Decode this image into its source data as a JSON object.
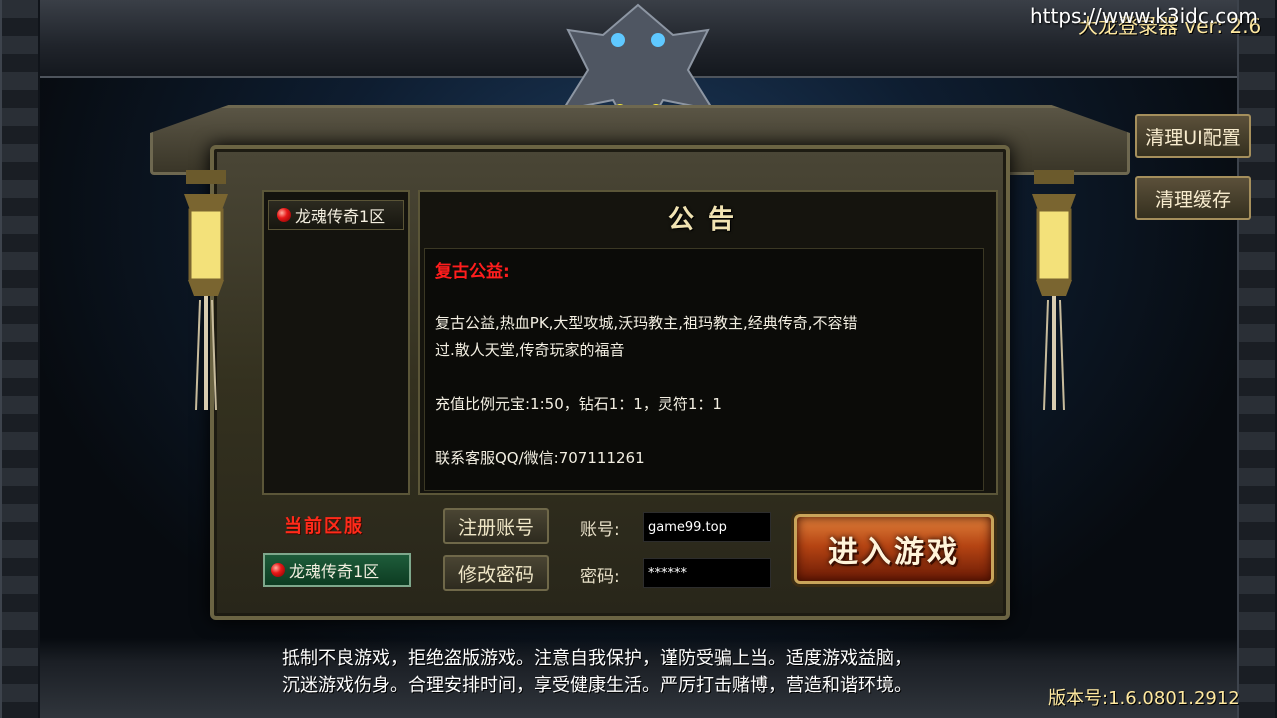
{
  "watermark": "https://www.k3idc.com",
  "launcher_title": "大龙登录器 ver: 2.6",
  "side_buttons": {
    "clear_ui": "清理UI配置",
    "clear_cache": "清理缓存"
  },
  "server_list": {
    "items": [
      {
        "label": "龙魂传奇1区",
        "status_color": "#e81818"
      }
    ]
  },
  "notice": {
    "title": "公告",
    "heading": "复古公益:",
    "lines": [
      " 复古公益,热血PK,大型攻城,沃玛教主,祖玛教主,经典传奇,不容错",
      "过.散人天堂,传奇玩家的福音",
      "充值比例元宝:1:50，钻石1：1，灵符1：1",
      "联系客服QQ/微信:707111261"
    ]
  },
  "current_zone": {
    "label": "当前区服",
    "value": "龙魂传奇1区"
  },
  "buttons": {
    "register": "注册账号",
    "change_password": "修改密码",
    "enter_game": "进入游戏"
  },
  "form": {
    "account_label": "账号:",
    "account_value": "game99.top",
    "password_label": "密码:",
    "password_value": "******"
  },
  "footer": {
    "line1": "抵制不良游戏，拒绝盗版游戏。注意自我保护，谨防受骗上当。适度游戏益脑，",
    "line2": "沉迷游戏伤身。合理安排时间，享受健康生活。严厉打击赌博，营造和谐环境。"
  },
  "version": "版本号:1.6.0801.2912",
  "colors": {
    "accent_red": "#ff1d1d",
    "gold": "#ffe9a0",
    "zone_green": "#1e5c3a"
  }
}
